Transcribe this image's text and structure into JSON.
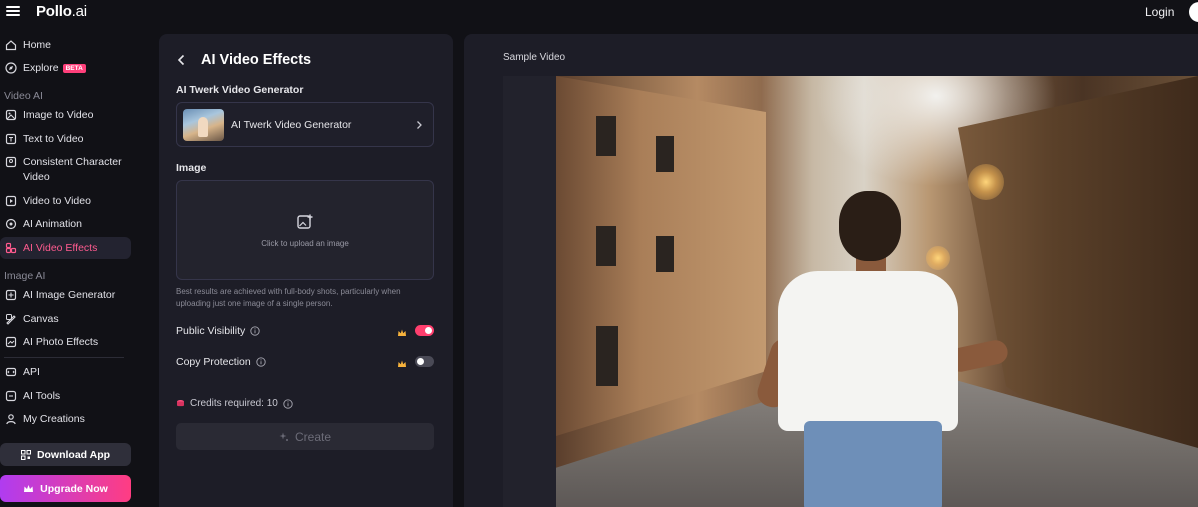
{
  "app": {
    "logo_main": "Pollo",
    "logo_suffix": ".ai",
    "login_label": "Login"
  },
  "sidebar": {
    "home": "Home",
    "explore": "Explore",
    "explore_badge": "BETA",
    "section_video": "Video AI",
    "image_to_video": "Image to Video",
    "text_to_video": "Text to Video",
    "consistent_character": "Consistent Character Video",
    "video_to_video": "Video to Video",
    "ai_animation": "AI Animation",
    "ai_video_effects": "AI Video Effects",
    "section_image": "Image AI",
    "ai_image_generator": "AI Image Generator",
    "canvas": "Canvas",
    "ai_photo_effects": "AI Photo Effects",
    "api": "API",
    "ai_tools": "AI Tools",
    "my_creations": "My Creations",
    "download_app": "Download App",
    "upgrade_now": "Upgrade Now"
  },
  "panel": {
    "title": "AI Video Effects",
    "effect_label": "AI Twerk Video Generator",
    "effect_selected": "AI Twerk Video Generator",
    "image_label": "Image",
    "upload_text": "Click to upload an image",
    "hint": "Best results are achieved with full-body shots, particularly when uploading just one image of a single person.",
    "public_visibility": "Public Visibility",
    "public_visibility_on": true,
    "copy_protection": "Copy Protection",
    "copy_protection_on": false,
    "credits_text": "Credits required: 10",
    "create_label": "Create"
  },
  "preview": {
    "label": "Sample Video"
  },
  "colors": {
    "accent": "#ff3f7a",
    "active_text": "#ff5b8f",
    "panel_bg": "#1d1d27",
    "page_bg": "#111116"
  }
}
